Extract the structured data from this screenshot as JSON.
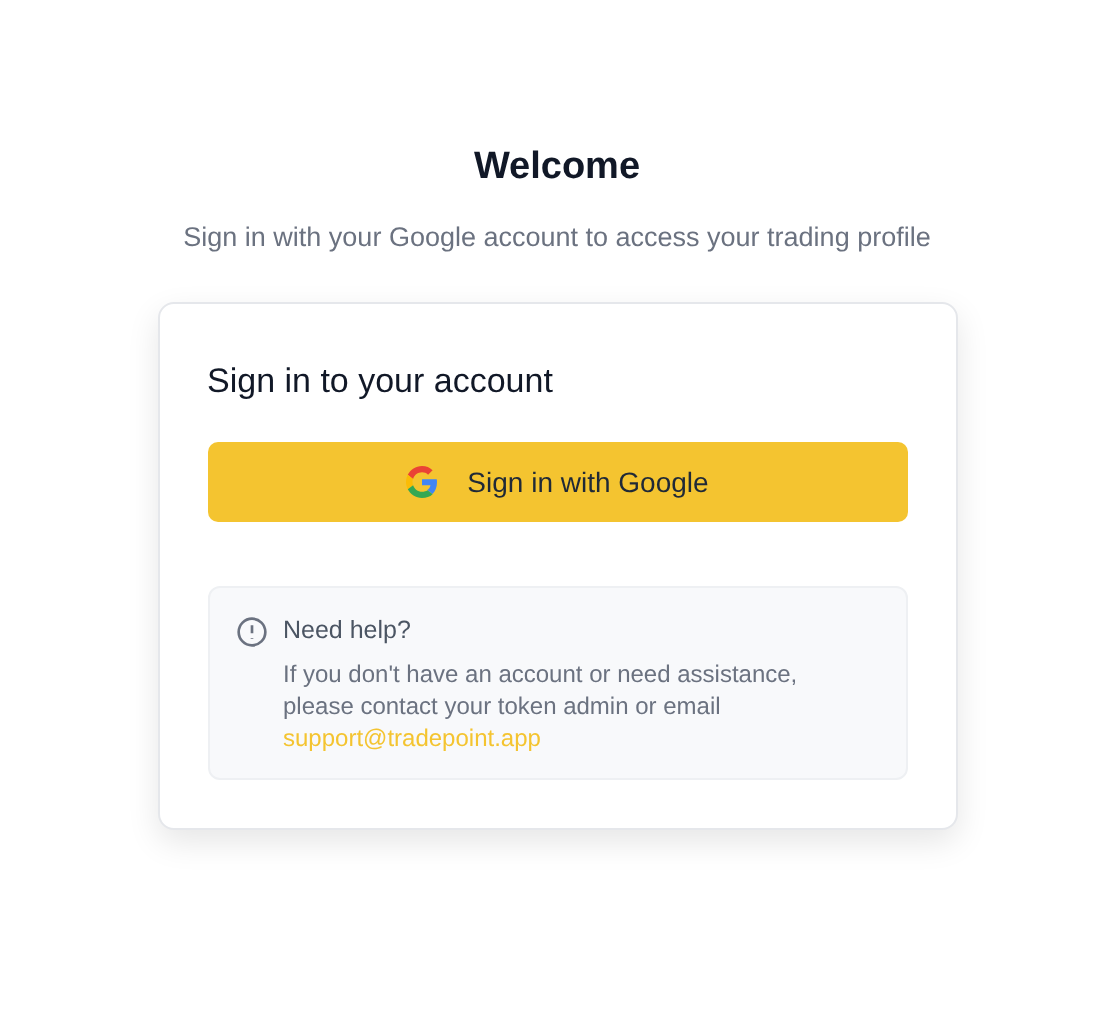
{
  "title": "Welcome",
  "subtitle": "Sign in with your Google account to access your trading profile",
  "card": {
    "heading": "Sign in to your account",
    "google_button": "Sign in with Google",
    "help": {
      "title": "Need help?",
      "body": "If you don't have an account or need assistance, please contact your token admin or email",
      "email": "support@tradepoint.app"
    }
  }
}
